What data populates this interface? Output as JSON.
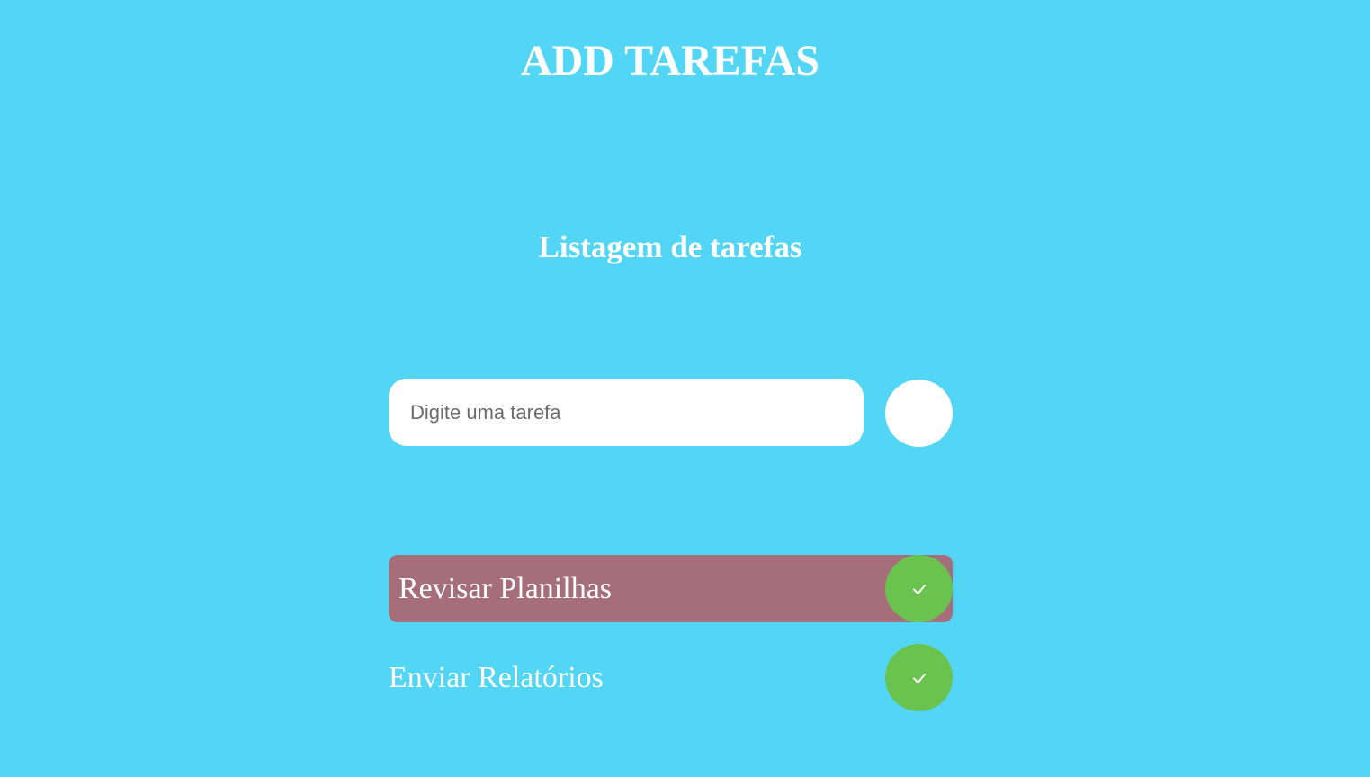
{
  "header": {
    "title": "ADD TAREFAS"
  },
  "list": {
    "heading": "Listagem de tarefas"
  },
  "input": {
    "placeholder": "Digite uma tarefa",
    "value": ""
  },
  "tasks": [
    {
      "label": "Revisar Planilhas",
      "highlighted": true,
      "complete_icon": "check-icon"
    },
    {
      "label": "Enviar Relatórios",
      "highlighted": false,
      "complete_icon": "check-icon"
    }
  ],
  "colors": {
    "background": "#53d5f5",
    "highlight": "#a66e7a",
    "check": "#6ac24f",
    "text": "#ffffff"
  }
}
